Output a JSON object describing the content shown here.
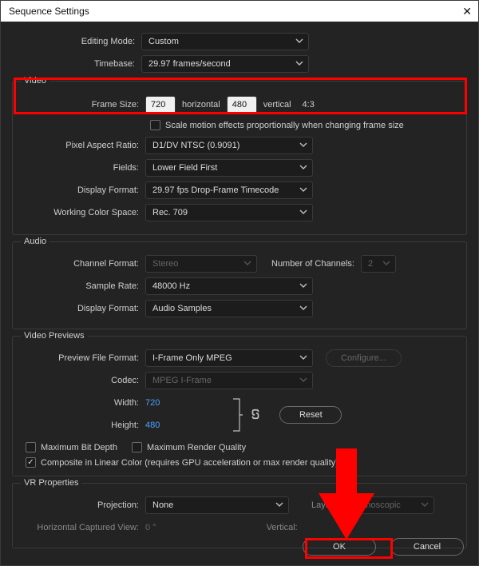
{
  "window": {
    "title": "Sequence Settings"
  },
  "general": {
    "editing_mode_label": "Editing Mode:",
    "editing_mode_value": "Custom",
    "timebase_label": "Timebase:",
    "timebase_value": "29.97  frames/second"
  },
  "video": {
    "legend": "Video",
    "frame_size_label": "Frame Size:",
    "frame_width": "720",
    "horizontal_label": "horizontal",
    "frame_height": "480",
    "vertical_label": "vertical",
    "aspect": "4:3",
    "scale_motion_label": "Scale motion effects proportionally when changing frame size",
    "pixel_aspect_label": "Pixel Aspect Ratio:",
    "pixel_aspect_value": "D1/DV NTSC (0.9091)",
    "fields_label": "Fields:",
    "fields_value": "Lower Field First",
    "display_format_label": "Display Format:",
    "display_format_value": "29.97 fps Drop-Frame Timecode",
    "color_space_label": "Working Color Space:",
    "color_space_value": "Rec. 709"
  },
  "audio": {
    "legend": "Audio",
    "channel_format_label": "Channel Format:",
    "channel_format_value": "Stereo",
    "num_channels_label": "Number of Channels:",
    "num_channels_value": "2",
    "sample_rate_label": "Sample Rate:",
    "sample_rate_value": "48000 Hz",
    "display_format_label": "Display Format:",
    "display_format_value": "Audio Samples"
  },
  "previews": {
    "legend": "Video Previews",
    "file_format_label": "Preview File Format:",
    "file_format_value": "I-Frame Only MPEG",
    "configure_label": "Configure...",
    "codec_label": "Codec:",
    "codec_value": "MPEG I-Frame",
    "width_label": "Width:",
    "width_value": "720",
    "height_label": "Height:",
    "height_value": "480",
    "reset_label": "Reset",
    "max_bit_depth_label": "Maximum Bit Depth",
    "max_render_quality_label": "Maximum Render Quality",
    "composite_label": "Composite in Linear Color (requires GPU acceleration or max render quality)"
  },
  "vr": {
    "legend": "VR Properties",
    "projection_label": "Projection:",
    "projection_value": "None",
    "layout_label": "Layout:",
    "layout_value": "Monoscopic",
    "hcv_label": "Horizontal Captured View:",
    "hcv_value": "0 °",
    "vertical_label": "Vertical:"
  },
  "footer": {
    "ok": "OK",
    "cancel": "Cancel"
  }
}
